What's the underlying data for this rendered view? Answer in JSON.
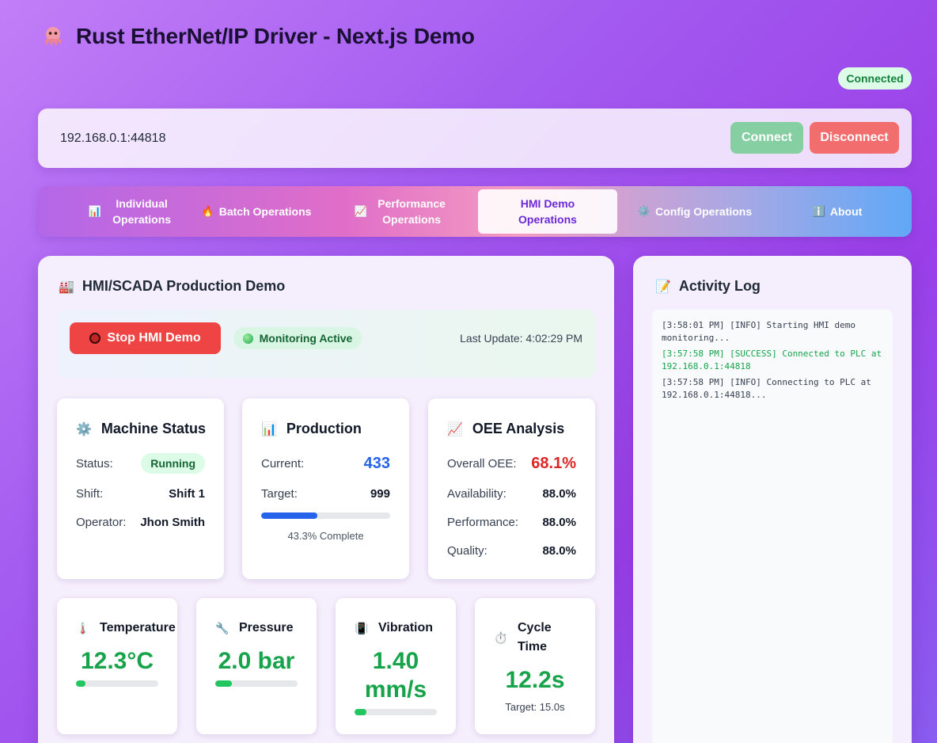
{
  "header": {
    "title": "Rust EtherNet/IP Driver - Next.js Demo",
    "app_icon": "octopus-icon",
    "status": "Connected"
  },
  "connection": {
    "address": "192.168.0.1:44818",
    "connect_label": "Connect",
    "disconnect_label": "Disconnect"
  },
  "tabs": [
    {
      "icon": "📊",
      "label": "Individual Operations"
    },
    {
      "icon": "🔥",
      "label": "Batch Operations"
    },
    {
      "icon": "📈",
      "label": "Performance Operations"
    },
    {
      "icon": "",
      "label": "HMI Demo Operations"
    },
    {
      "icon": "⚙️",
      "label": "Config Operations"
    },
    {
      "icon": "ℹ️",
      "label": "About"
    }
  ],
  "hmi": {
    "title": "HMI/SCADA Production Demo",
    "title_icon": "🏭",
    "stop_label": "Stop HMI Demo",
    "monitoring_label": "Monitoring Active",
    "last_update": "Last Update: 4:02:29 PM"
  },
  "machine": {
    "icon": "⚙️",
    "title": "Machine Status",
    "status_label": "Status:",
    "status_value": "Running",
    "shift_label": "Shift:",
    "shift_value": "Shift 1",
    "operator_label": "Operator:",
    "operator_value": "Jhon Smith"
  },
  "production": {
    "icon": "📊",
    "title": "Production",
    "current_label": "Current:",
    "current_value": "433",
    "target_label": "Target:",
    "target_value": "999",
    "progress_fraction": 0.433,
    "progress_text": "43.3% Complete"
  },
  "oee": {
    "icon": "📈",
    "title": "OEE Analysis",
    "overall_label": "Overall OEE:",
    "overall_value": "68.1%",
    "availability_label": "Availability:",
    "availability_value": "88.0%",
    "performance_label": "Performance:",
    "performance_value": "88.0%",
    "quality_label": "Quality:",
    "quality_value": "88.0%"
  },
  "sensors": {
    "temperature": {
      "icon": "🌡️",
      "title": "Temperature",
      "value": "12.3°C",
      "fraction": 0.12
    },
    "pressure": {
      "icon": "🔧",
      "title": "Pressure",
      "value": "2.0 bar",
      "fraction": 0.2
    },
    "vibration": {
      "icon": "📳",
      "title": "Vibration",
      "value_line1": "1.40",
      "value_line2": "mm/s",
      "fraction": 0.14
    },
    "cycle": {
      "icon": "⏱️",
      "title_line1": "Cycle",
      "title_line2": "Time",
      "value": "12.2s",
      "target": "Target: 15.0s"
    }
  },
  "log": {
    "title": "Activity Log",
    "icon": "📝",
    "entries": [
      {
        "text": "[3:58:01 PM] [INFO] Starting HMI demo monitoring...",
        "level": "info"
      },
      {
        "text": "[3:57:58 PM] [SUCCESS] Connected to PLC at 192.168.0.1:44818",
        "level": "success"
      },
      {
        "text": "[3:57:58 PM] [INFO] Connecting to PLC at 192.168.0.1:44818...",
        "level": "info"
      }
    ]
  },
  "colors": {
    "accent_purple": "#9a3fe8",
    "success": "#16a34a",
    "danger": "#ef4444",
    "primary": "#2563eb"
  }
}
